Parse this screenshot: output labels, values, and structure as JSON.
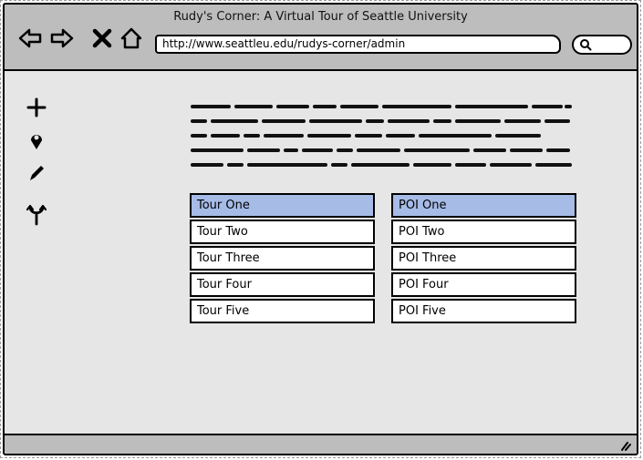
{
  "window": {
    "title": "Rudy's Corner: A Virtual Tour of Seattle University"
  },
  "browser": {
    "url": "http://www.seattleu.edu/rudys-corner/admin",
    "nav": [
      "back-arrow-icon",
      "forward-arrow-icon",
      "close-icon",
      "home-icon"
    ]
  },
  "tools": [
    "plus-icon",
    "map-pin-icon",
    "pencil-icon",
    "merge-icon"
  ],
  "tours": {
    "items": [
      "Tour One",
      "Tour Two",
      "Tour Three",
      "Tour Four",
      "Tour Five"
    ],
    "selected_index": 0
  },
  "pois": {
    "items": [
      "POI One",
      "POI Two",
      "POI Three",
      "POI Four",
      "POI Five"
    ],
    "selected_index": 0
  },
  "colors": {
    "selected": "#a6bbe6",
    "chrome": "#bdbdbd",
    "canvas": "#e6e6e6"
  }
}
